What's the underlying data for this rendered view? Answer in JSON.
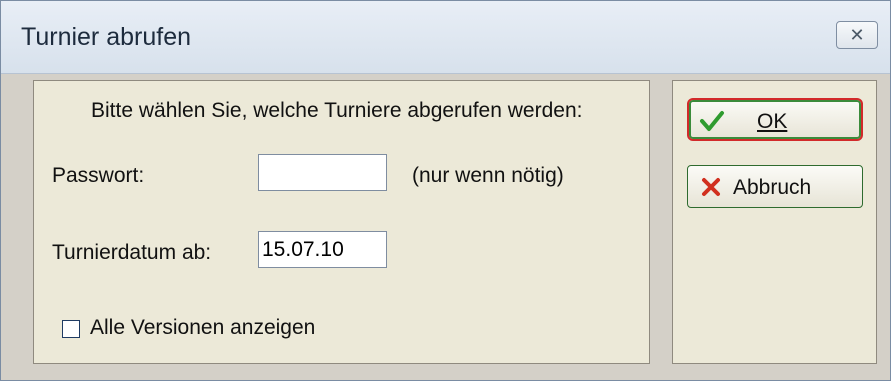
{
  "window": {
    "title": "Turnier abrufen",
    "close_icon": "close-icon"
  },
  "form": {
    "instruction": "Bitte wählen Sie, welche Turniere abgerufen werden:",
    "password_label": "Passwort:",
    "password_value": "",
    "password_hint": "(nur wenn nötig)",
    "date_label": "Turnierdatum ab:",
    "date_value": "15.07.10",
    "checkbox_label": "Alle Versionen anzeigen",
    "checkbox_checked": false
  },
  "buttons": {
    "ok_label": "OK",
    "ok_icon": "checkmark-icon",
    "cancel_label": "Abbruch",
    "cancel_icon": "x-icon"
  },
  "colors": {
    "ok_focus_outline": "#d22a2a",
    "button_border": "#2e6b2e",
    "check_green": "#2f9b2f",
    "x_red": "#d1301f"
  }
}
